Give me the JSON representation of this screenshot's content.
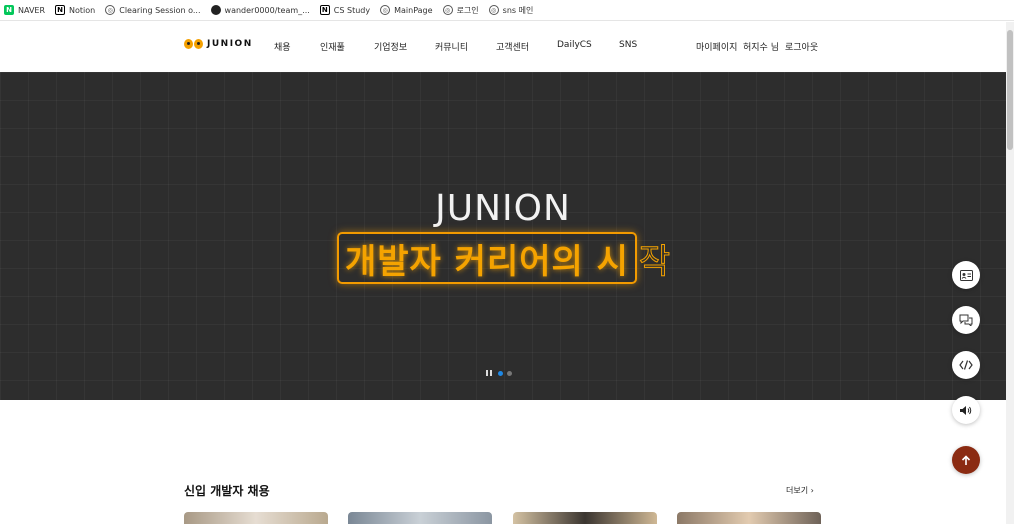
{
  "bookmarks": [
    {
      "label": "NAVER",
      "icon": "naver-icon"
    },
    {
      "label": "Notion",
      "icon": "notion-icon"
    },
    {
      "label": "Clearing Session o...",
      "icon": "globe-icon"
    },
    {
      "label": "wander0000/team_...",
      "icon": "github-icon"
    },
    {
      "label": "CS Study",
      "icon": "notion-icon"
    },
    {
      "label": "MainPage",
      "icon": "globe-icon"
    },
    {
      "label": "로그인",
      "icon": "globe-icon"
    },
    {
      "label": "sns 메인",
      "icon": "globe-icon"
    }
  ],
  "header": {
    "logo_text": "JUNION",
    "nav": [
      "채용",
      "인재풀",
      "기업정보",
      "커뮤니티",
      "고객센터",
      "DailyCS",
      "SNS"
    ],
    "mypage": "마이페이지",
    "user": "허지수 님",
    "logout": "로그아웃"
  },
  "hero": {
    "title": "JUNION",
    "subtitle_highlight": "개발자 커리어의 시",
    "subtitle_tail": "작",
    "slides_total": 2,
    "slide_active": 1
  },
  "section": {
    "title": "신입 개발자 채용",
    "more": "더보기"
  },
  "colors": {
    "accent_orange": "#f5a300",
    "hero_bg": "#2d2d2d",
    "up_button": "#8b2b12",
    "active_dot": "#1e88e5"
  }
}
